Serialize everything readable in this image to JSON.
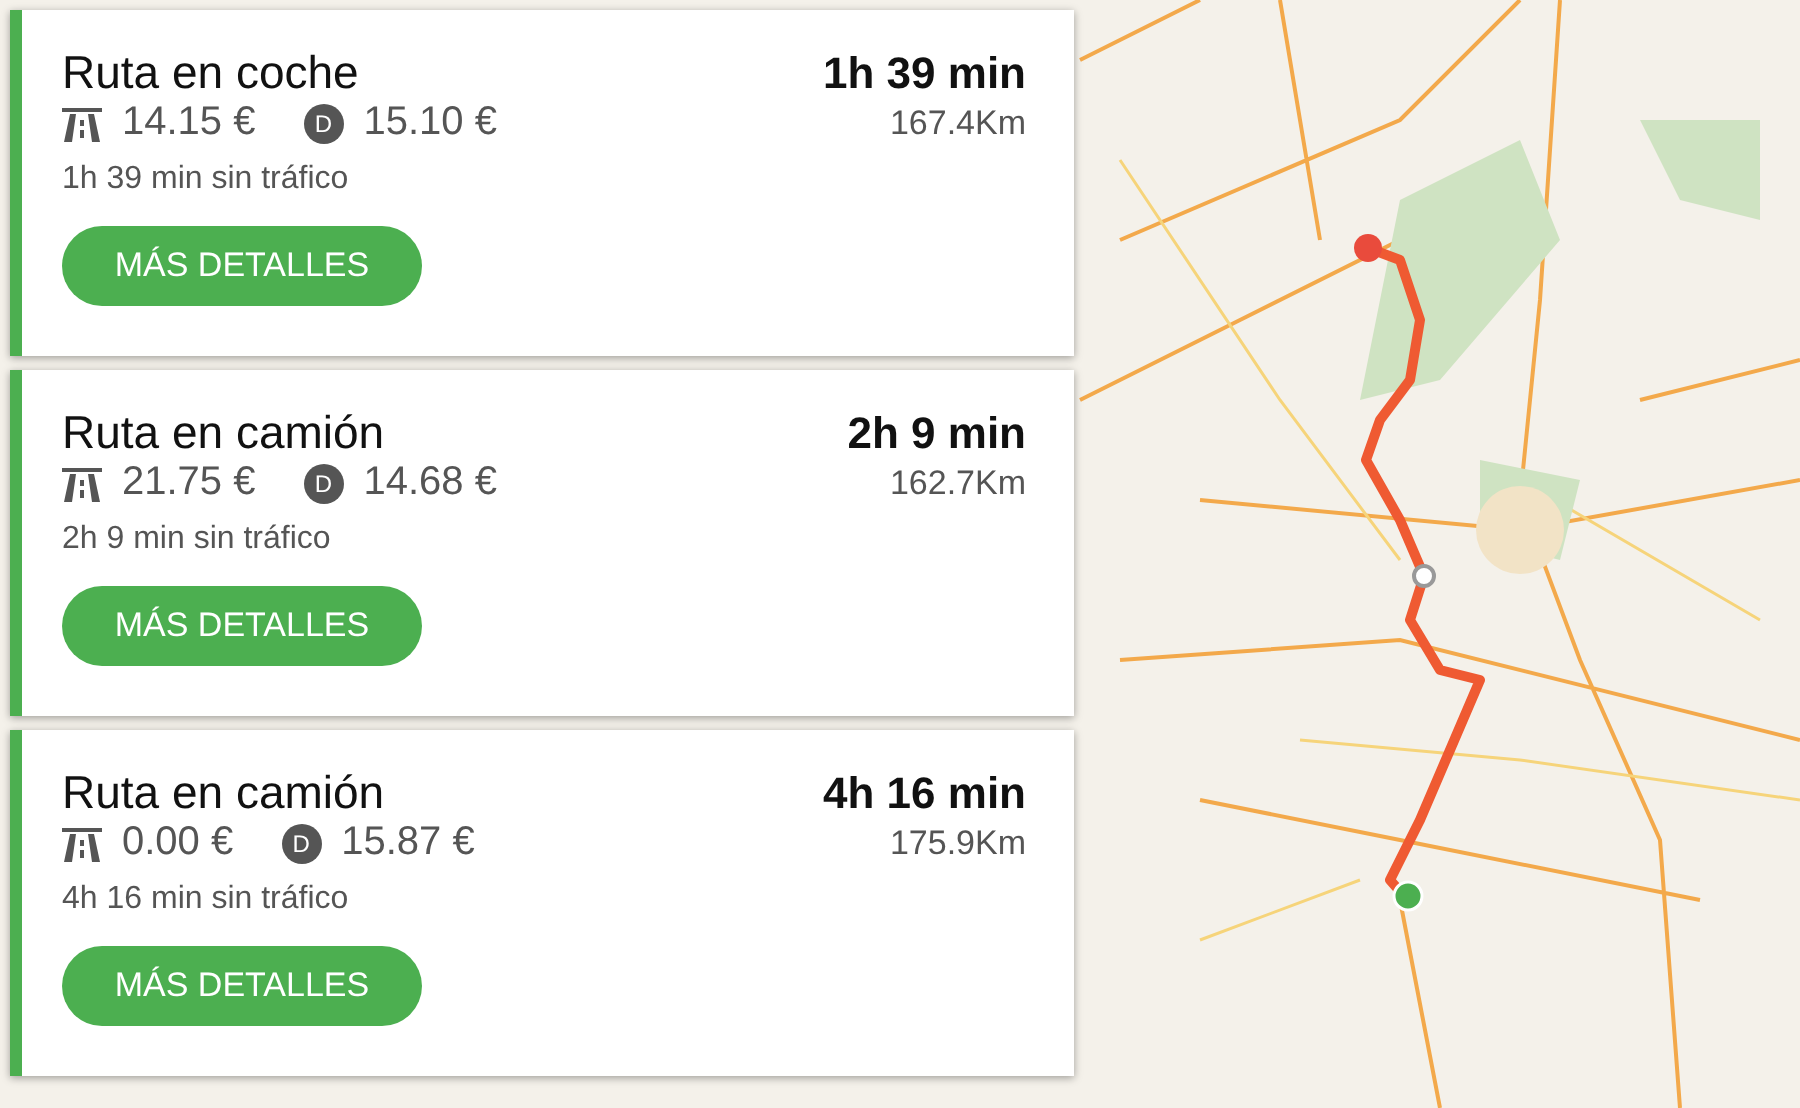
{
  "routes": [
    {
      "title": "Ruta en coche",
      "duration": "1h 39 min",
      "toll": "14.15 €",
      "diesel_badge": "D",
      "fuel": "15.10 €",
      "distance": "167.4Km",
      "no_traffic": "1h 39 min sin tráfico",
      "button": "MÁS DETALLES"
    },
    {
      "title": "Ruta en camión",
      "duration": "2h 9 min",
      "toll": "21.75 €",
      "diesel_badge": "D",
      "fuel": "14.68 €",
      "distance": "162.7Km",
      "no_traffic": "2h 9 min sin tráfico",
      "button": "MÁS DETALLES"
    },
    {
      "title": "Ruta en camión",
      "duration": "4h 16 min",
      "toll": "0.00 €",
      "diesel_badge": "D",
      "fuel": "15.87 €",
      "distance": "175.9Km",
      "no_traffic": "4h 16 min sin tráfico",
      "button": "MÁS DETALLES"
    }
  ]
}
